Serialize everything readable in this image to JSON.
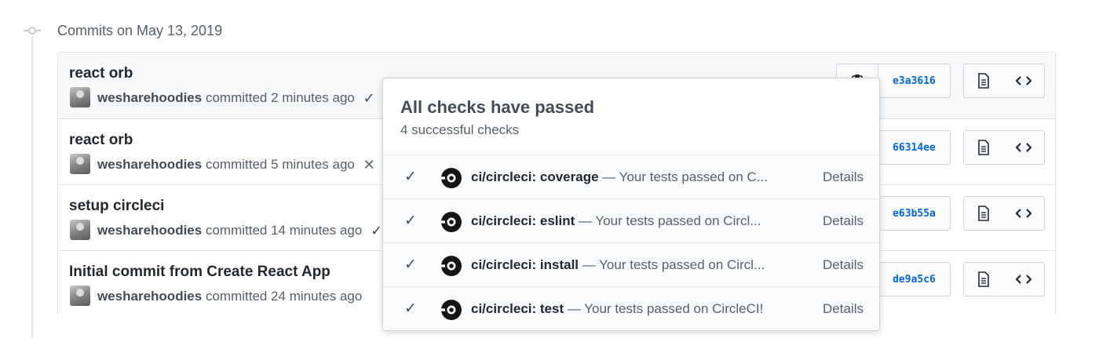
{
  "timeline": {
    "date_heading": "Commits on May 13, 2019"
  },
  "commits": [
    {
      "title": "react orb",
      "author": "wesharehoodies",
      "time": "committed 2 minutes ago",
      "status": "✓",
      "sha": "e3a3616"
    },
    {
      "title": "react orb",
      "author": "wesharehoodies",
      "time": "committed 5 minutes ago",
      "status": "✕",
      "sha": "66314ee"
    },
    {
      "title": "setup circleci",
      "author": "wesharehoodies",
      "time": "committed 14 minutes ago",
      "status": "✓",
      "sha": "e63b55a"
    },
    {
      "title": "Initial commit from Create React App",
      "author": "wesharehoodies",
      "time": "committed 24 minutes ago",
      "status": "",
      "sha": "de9a5c6"
    }
  ],
  "popover": {
    "title": "All checks have passed",
    "subtitle": "4 successful checks",
    "checks": [
      {
        "context": "ci/circleci: coverage",
        "description": " — Your tests passed on C...",
        "details": "Details"
      },
      {
        "context": "ci/circleci: eslint",
        "description": " — Your tests passed on Circl...",
        "details": "Details"
      },
      {
        "context": "ci/circleci: install",
        "description": " — Your tests passed on Circl...",
        "details": "Details"
      },
      {
        "context": "ci/circleci: test",
        "description": " — Your tests passed on CircleCI!",
        "details": "Details"
      }
    ]
  },
  "icons": {
    "timeline": "git-commit-icon",
    "success": "check-icon",
    "failure": "x-icon",
    "copy": "clippy-icon",
    "browse": "file-icon",
    "code": "code-icon",
    "ci": "circleci-icon"
  },
  "colors": {
    "sha_link": "#0366d6",
    "border": "#e1e4e8",
    "muted_text": "#586069"
  }
}
